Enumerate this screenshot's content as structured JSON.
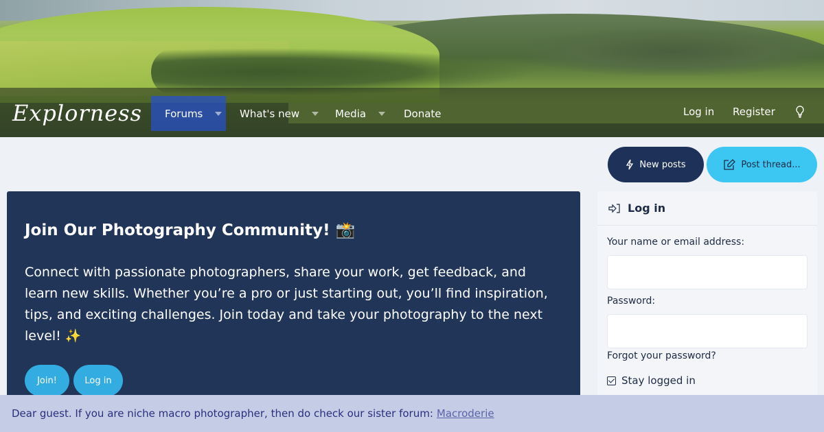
{
  "header": {
    "logo_text": "Explorness",
    "nav": [
      {
        "label": "Forums",
        "has_dropdown": true,
        "active": true
      },
      {
        "label": "What's new",
        "has_dropdown": true,
        "active": false
      },
      {
        "label": "Media",
        "has_dropdown": true,
        "active": false
      },
      {
        "label": "Donate",
        "has_dropdown": false,
        "active": false
      }
    ],
    "login_label": "Log in",
    "register_label": "Register",
    "theme_icon": "lightbulb-icon"
  },
  "actions": {
    "new_posts_label": "New posts",
    "new_posts_icon": "lightning-bolt-icon",
    "post_thread_label": "Post thread...",
    "post_thread_icon": "edit-icon"
  },
  "welcome": {
    "title": "Join Our Photography Community! 📸",
    "body": "Connect with passionate photographers, share your work, get feedback, and learn new skills. Whether you’re a pro or just starting out, you’ll find inspiration, tips, and exciting challenges. Join today and take your photography to the next level! ✨",
    "join_label": "Join!",
    "login_label": "Log in"
  },
  "login_panel": {
    "title": "Log in",
    "icon": "sign-in-icon",
    "username_label": "Your name or email address:",
    "username_value": "",
    "password_label": "Password:",
    "password_value": "",
    "forgot_label": "Forgot your password?",
    "stay_logged_in_label": "Stay logged in",
    "stay_logged_in_checked": true
  },
  "notice": {
    "text": "Dear guest. If you are niche macro photographer, then do check our sister forum:",
    "link_label": "Macroderie"
  },
  "colors": {
    "navy": "#213559",
    "button_dark": "#1e3158",
    "button_cyan": "#3cc7f2",
    "pill_blue": "#33ace1",
    "notice_bg": "#c5cde6",
    "active_nav": "#2850c8"
  }
}
